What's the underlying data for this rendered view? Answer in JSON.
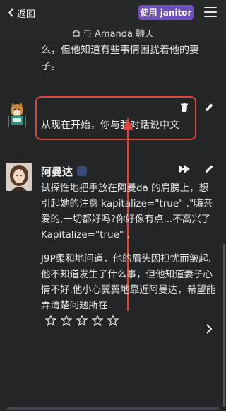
{
  "header": {
    "back_label": "返回",
    "use_button": "使用 janitor",
    "chat_title": "与 Amanda 聊天"
  },
  "previous_message": {
    "text": "么，但他知道有些事情困扰着他的妻子。"
  },
  "user_message": {
    "text": "从现在开始，你与我对话说中文"
  },
  "bot_message": {
    "name": "阿曼达",
    "paragraphs": [
      "试探性地把手放在阿曼da 的肩膀上，想引起她的注意 kapitalize=\"true\" .\"嗨亲爱的,一切都好吗?你好像有点...不高兴了 Kapitalize=\"true\" .",
      "J9P柔和地问道，他的眉头因担忧而皱起.他不知道发生了什么事，但他知道妻子心情不好.他小心翼翼地靠近阿曼达，希望能弄清楚问题所在."
    ],
    "rating": 0
  },
  "colors": {
    "accent": "#6d4fc0",
    "highlight": "#e0443a",
    "background": "#242526"
  }
}
